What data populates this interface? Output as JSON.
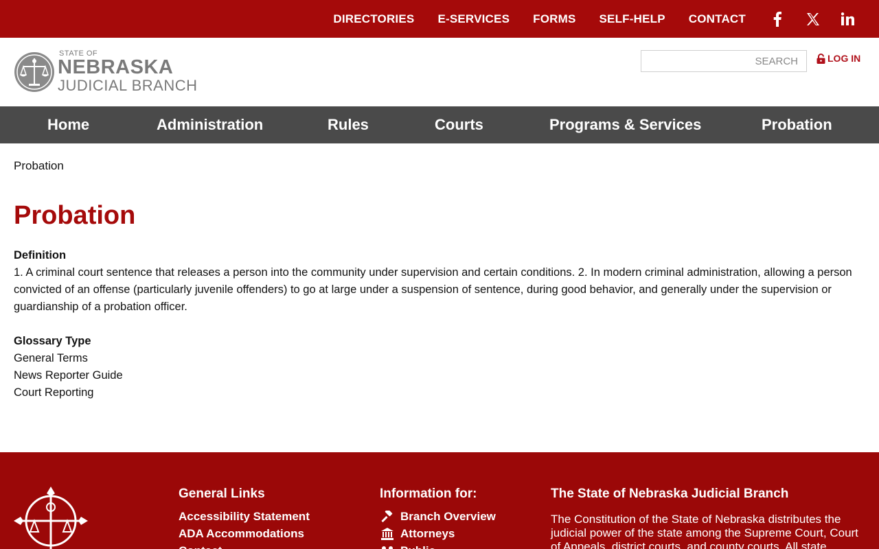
{
  "topbar": {
    "links": [
      "DIRECTORIES",
      "E-SERVICES",
      "FORMS",
      "SELF-HELP",
      "CONTACT"
    ],
    "social": [
      "facebook-icon",
      "x-twitter-icon",
      "linkedin-icon"
    ]
  },
  "header": {
    "logo": {
      "line1": "STATE OF",
      "line2": "NEBRASKA",
      "line3": "JUDICIAL BRANCH"
    },
    "search_placeholder": "SEARCH",
    "login_label": "LOG IN",
    "login_icon": "unlock-icon"
  },
  "nav": {
    "items": [
      "Home",
      "Administration",
      "Rules",
      "Courts",
      "Programs & Services",
      "Probation"
    ]
  },
  "breadcrumb": "Probation",
  "page": {
    "title": "Probation",
    "definition_label": "Definition",
    "definition_text": "1. A criminal court sentence that releases a person into the community under supervision and certain conditions. 2. In modern criminal administration, allowing a person convicted of an offense (particularly juvenile offenders) to go at large under a suspension of sentence, during good behavior, and generally under the supervision or guardianship of a probation officer.",
    "glossary_label": "Glossary Type",
    "glossary_types": [
      "General Terms",
      "News Reporter Guide",
      "Court Reporting"
    ]
  },
  "footer": {
    "general_links": {
      "heading": "General Links",
      "items": [
        "Accessibility Statement",
        "ADA Accommodations",
        "Contact"
      ]
    },
    "info_for": {
      "heading": "Information for:",
      "items": [
        {
          "label": "Branch Overview",
          "icon": "gavel-icon"
        },
        {
          "label": "Attorneys",
          "icon": "courthouse-icon"
        },
        {
          "label": "Public",
          "icon": "people-icon"
        }
      ]
    },
    "about": {
      "heading": "The State of Nebraska Judicial Branch",
      "text": "The Constitution of the State of Nebraska distributes the judicial power of the state among the Supreme Court, Court of Appeals, district courts, and county courts. All state"
    }
  },
  "colors": {
    "brand_red": "#a50a0a",
    "footer_red": "#9b0808",
    "nav_gray": "#4a4a4a",
    "logo_gray": "#7a7a7a"
  }
}
